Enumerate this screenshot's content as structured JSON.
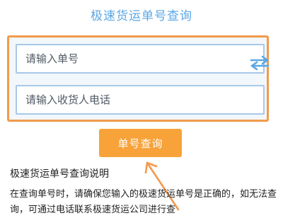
{
  "header": {
    "title": "极速货运单号查询"
  },
  "form": {
    "tracking_placeholder": "请输入单号",
    "phone_placeholder": "请输入收货人电话",
    "swap_icon": "swap-arrows-icon"
  },
  "actions": {
    "query_label": "单号查询"
  },
  "info": {
    "title": "极速货运单号查询说明",
    "text": "在查询单号时，请确保您输入的极速货运单号是正确的，如无法查询，可通过电话联系极速货运公司进行查"
  },
  "colors": {
    "accent_orange": "#f39a4c",
    "button_orange": "#f7a33a",
    "title_blue": "#5aa7e6",
    "field_border_blue": "#a8c8e8"
  }
}
